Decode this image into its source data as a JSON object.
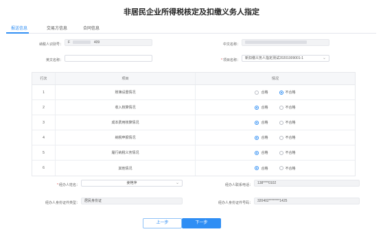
{
  "page": {
    "title": "非居民企业所得税核定及扣缴义务人指定"
  },
  "tabs": [
    {
      "label": "报送信息",
      "active": true
    },
    {
      "label": "交易方信息",
      "active": false
    },
    {
      "label": "合同信息",
      "active": false
    }
  ],
  "basic_info": {
    "taxpayer_id_label": "纳税人识别号：",
    "taxpayer_id_prefix": "F",
    "taxpayer_id_suffix": "409",
    "chinese_name_label": "中文名称：",
    "english_name_label": "英文名称：",
    "english_name_value": "",
    "project_name_label": "项目名称：",
    "project_name_value": "新扣缴义务人指定测试20201009001-1"
  },
  "table": {
    "headers": [
      "行次",
      "项目",
      "情况"
    ],
    "option_yes": "合格",
    "option_no": "不合格",
    "rows": [
      {
        "index": "1",
        "item": "账簿设置情况",
        "selected": "no"
      },
      {
        "index": "2",
        "item": "收入核算情况",
        "selected": "yes"
      },
      {
        "index": "3",
        "item": "成本费用核算情况",
        "selected": "yes"
      },
      {
        "index": "4",
        "item": "纳税申报情况",
        "selected": "yes"
      },
      {
        "index": "5",
        "item": "履行纳税义务情况",
        "selected": "yes"
      },
      {
        "index": "6",
        "item": "其他情况",
        "selected": "yes"
      }
    ]
  },
  "handler": {
    "name_label": "经办人姓名：",
    "name_value": "姜艳萍",
    "phone_label": "经办人联系电话：",
    "phone_value": "138****0102",
    "id_type_label": "经办人身份证件类型：",
    "id_type_value": "居民身份证",
    "id_no_label": "经办人身份证件号码：",
    "id_no_value": "320402********1425"
  },
  "buttons": {
    "prev": "上一步",
    "next": "下一步"
  },
  "colors": {
    "accent": "#2f8ef4",
    "required": "#e04848"
  }
}
